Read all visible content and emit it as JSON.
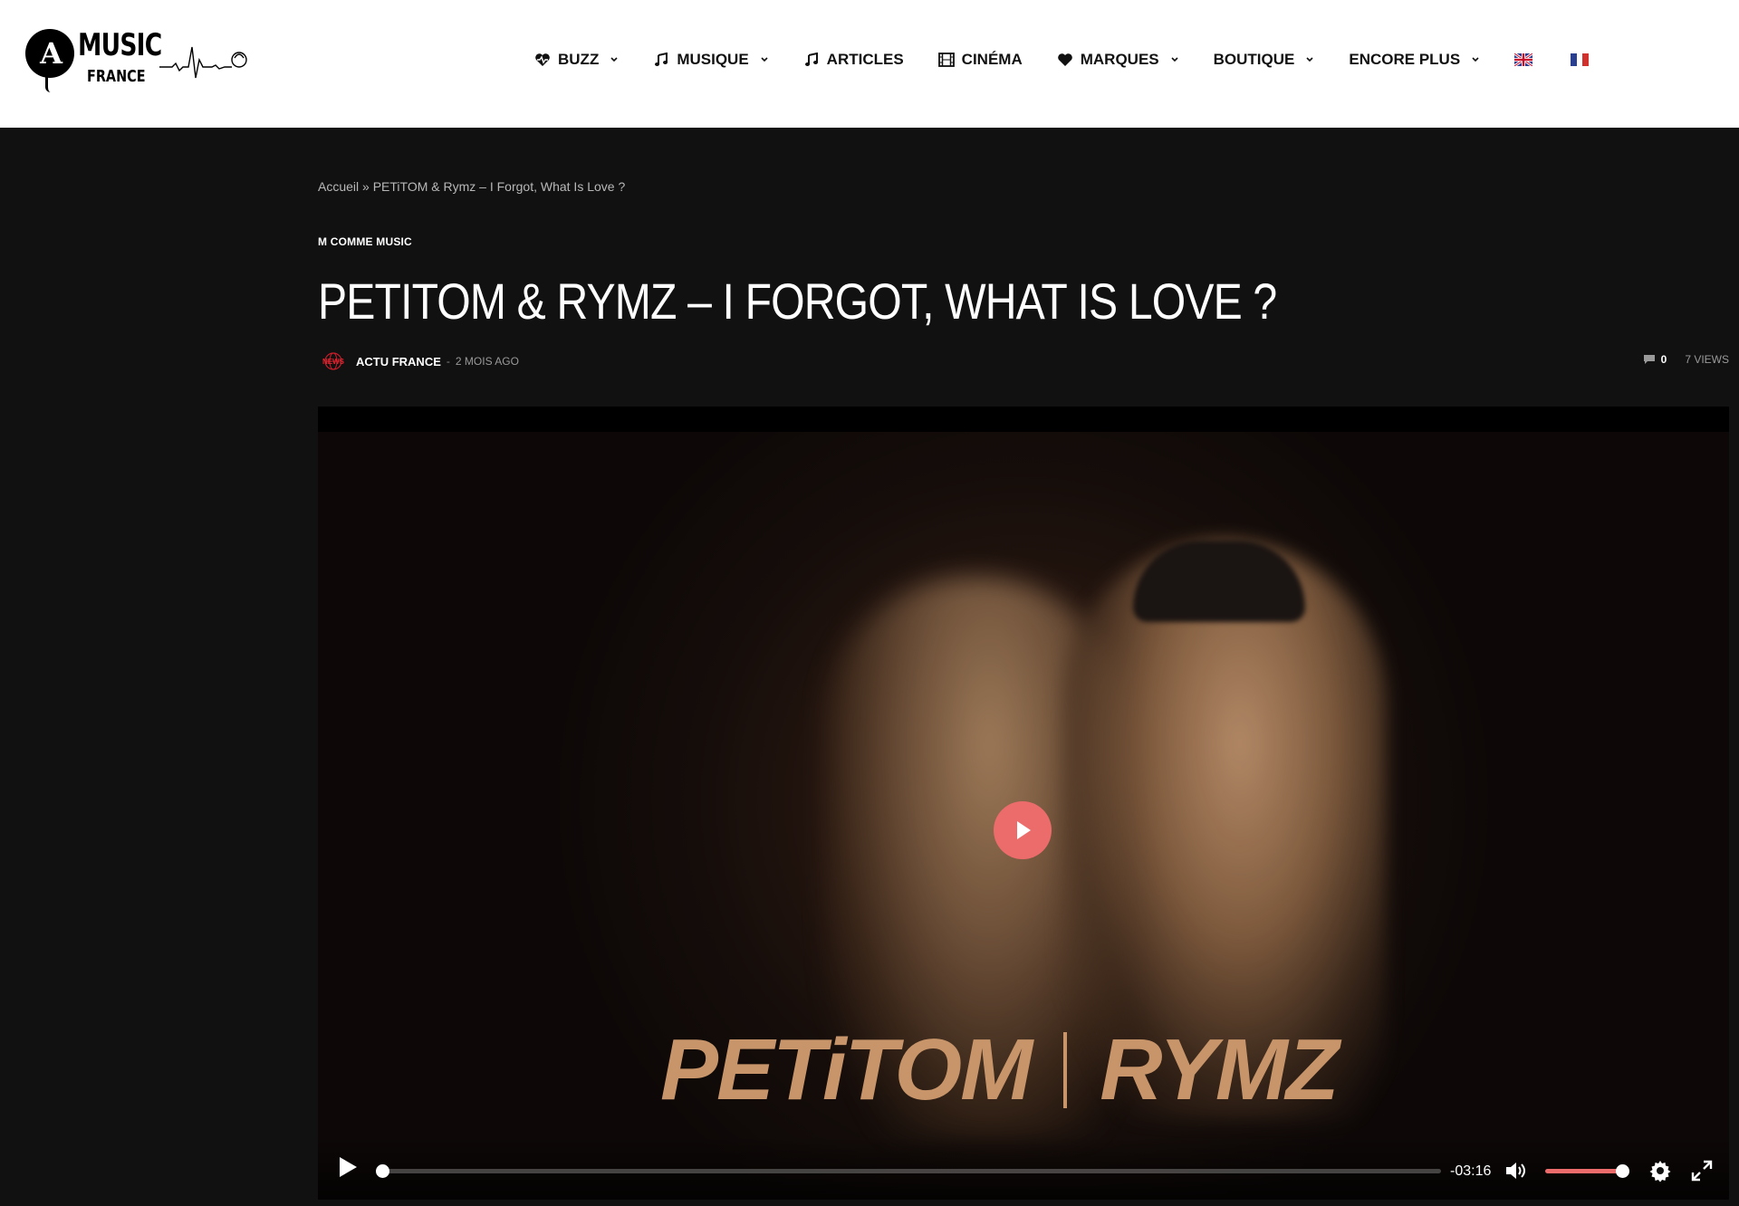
{
  "brand": {
    "logo_letter": "A",
    "logo_music": "MUSIC",
    "logo_france": "FRANCE"
  },
  "nav": {
    "items": [
      {
        "label": "BUZZ",
        "icon": "heartbeat-icon",
        "dropdown": true
      },
      {
        "label": "MUSIQUE",
        "icon": "music-note-icon",
        "dropdown": true
      },
      {
        "label": "ARTICLES",
        "icon": "music-note-icon",
        "dropdown": false
      },
      {
        "label": "CINÉMA",
        "icon": "film-icon",
        "dropdown": false
      },
      {
        "label": "MARQUES",
        "icon": "heart-icon",
        "dropdown": true
      },
      {
        "label": "BOUTIQUE",
        "icon": "",
        "dropdown": true
      },
      {
        "label": "ENCORE PLUS",
        "icon": "",
        "dropdown": true
      }
    ],
    "flags": [
      "uk-flag-icon",
      "france-flag-icon"
    ]
  },
  "breadcrumb": {
    "home": "Accueil",
    "separator": "»",
    "current": "PETiTOM & Rymz – I Forgot, What Is Love ?"
  },
  "post": {
    "category": "M COMME MUSIC",
    "title": "PETITOM & RYMZ – I FORGOT, WHAT IS LOVE ?",
    "author_badge": "NEWS",
    "author": "ACTU FRANCE",
    "separator": "-",
    "date": "2 MOIS AGO",
    "comments": "0",
    "views": "7 VIEWS"
  },
  "video": {
    "poster_left": "PETiTOM",
    "poster_right": "RYMZ",
    "time_remaining": "-03:16",
    "progress": 0.0,
    "volume": 1.0,
    "accent_color": "#ec6b6b"
  }
}
